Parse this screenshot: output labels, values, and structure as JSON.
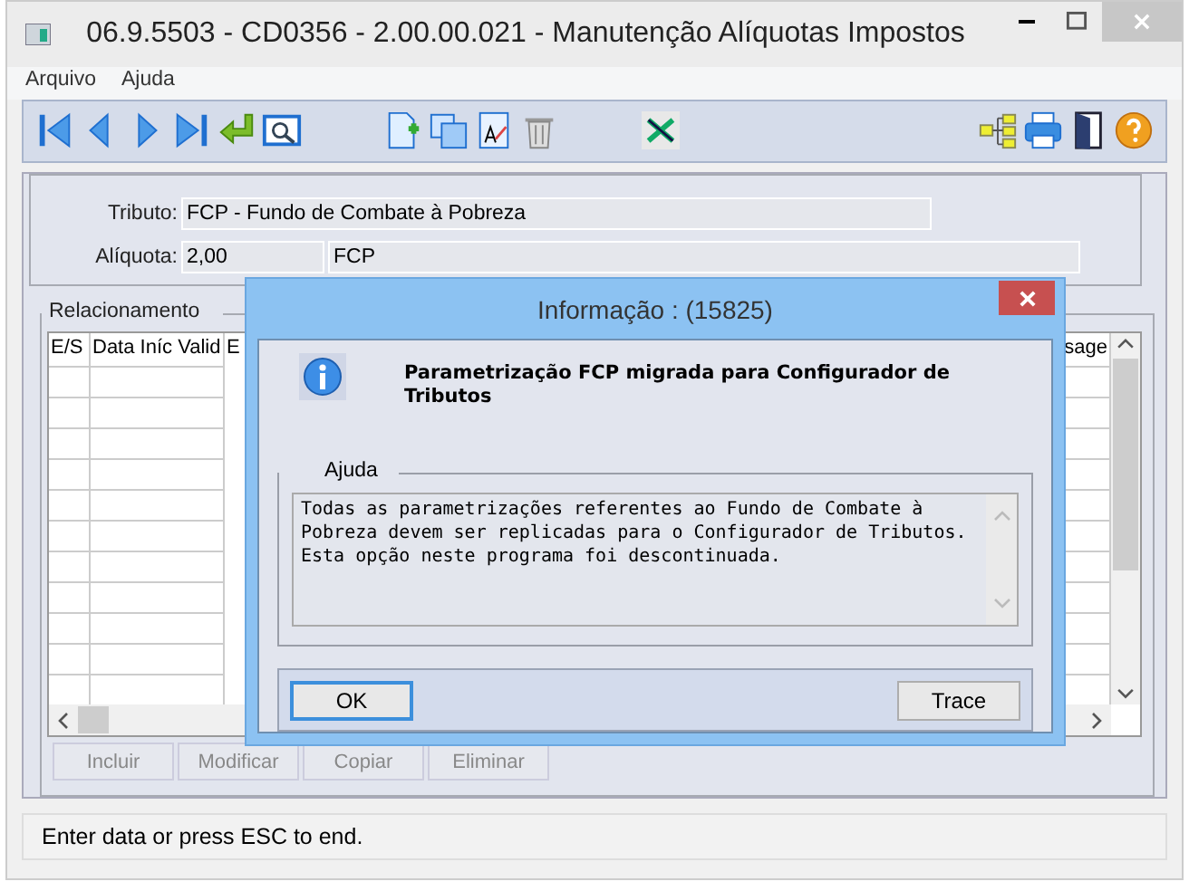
{
  "window": {
    "title": "06.9.5503 - CD0356 - 2.00.00.021 - Manutenção Alíquotas Impostos"
  },
  "menu": [
    "Arquivo",
    "Ajuda"
  ],
  "form": [
    {
      "label": "Tributo:",
      "values": [
        "FCP - Fundo de Combate à Pobreza"
      ]
    },
    {
      "label": "Alíquota:",
      "values": [
        "2,00",
        "FCP"
      ]
    }
  ],
  "relacionamento": {
    "title": "Relacionamento",
    "columns": [
      "E/S",
      "Data Iníc Valid",
      "E",
      "sage"
    ],
    "buttons": [
      {
        "label": "Incluir",
        "disabled": true
      },
      {
        "label": "Modificar",
        "disabled": true
      },
      {
        "label": "Copiar",
        "disabled": true
      },
      {
        "label": "Eliminar",
        "disabled": true
      }
    ]
  },
  "status_bar": "Enter data or press ESC to end.",
  "dialog": {
    "title": "Informação : (15825)",
    "message": "Parametrização FCP migrada para Configurador de Tributos",
    "group_title": "Ajuda",
    "help_text": [
      "Todas as parametrizações referentes ao Fundo de Combate à",
      "Pobreza devem ser replicadas para o Configurador de Tributos.",
      "Esta opção neste programa foi descontinuada."
    ],
    "buttons": [
      {
        "label": "OK",
        "default": true
      },
      {
        "label": "Trace",
        "default": false
      }
    ]
  }
}
